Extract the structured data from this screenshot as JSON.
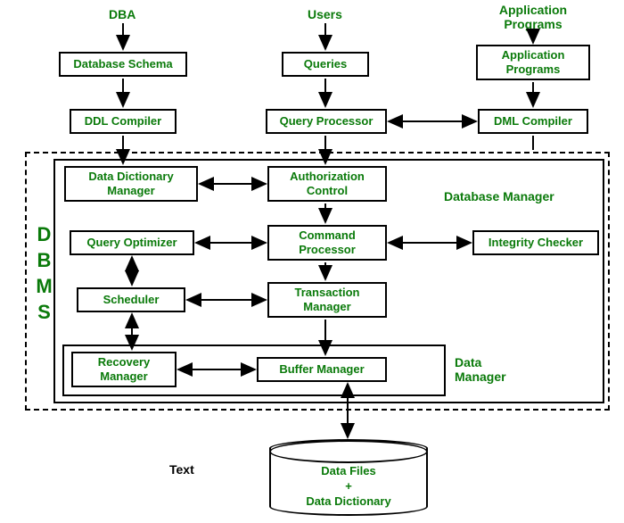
{
  "actors": {
    "dba": "DBA",
    "users": "Users",
    "app_programs": "Application\nPrograms"
  },
  "nodes": {
    "db_schema": "Database Schema",
    "queries": "Queries",
    "app_programs_box": "Application\nPrograms",
    "ddl_compiler": "DDL Compiler",
    "query_processor": "Query Processor",
    "dml_compiler": "DML Compiler",
    "data_dict_mgr": "Data Dictionary\nManager",
    "auth_control": "Authorization\nControl",
    "query_optimizer": "Query Optimizer",
    "command_proc": "Command\nProcessor",
    "integrity_checker": "Integrity Checker",
    "scheduler": "Scheduler",
    "txn_mgr": "Transaction\nManager",
    "recovery_mgr": "Recovery\nManager",
    "buffer_mgr": "Buffer Manager"
  },
  "labels": {
    "dbms": "DBMS",
    "db_manager": "Database Manager",
    "data_manager": "Data\nManager",
    "text": "Text"
  },
  "storage": {
    "cylinder": "Data Files\n+\nData Dictionary"
  }
}
